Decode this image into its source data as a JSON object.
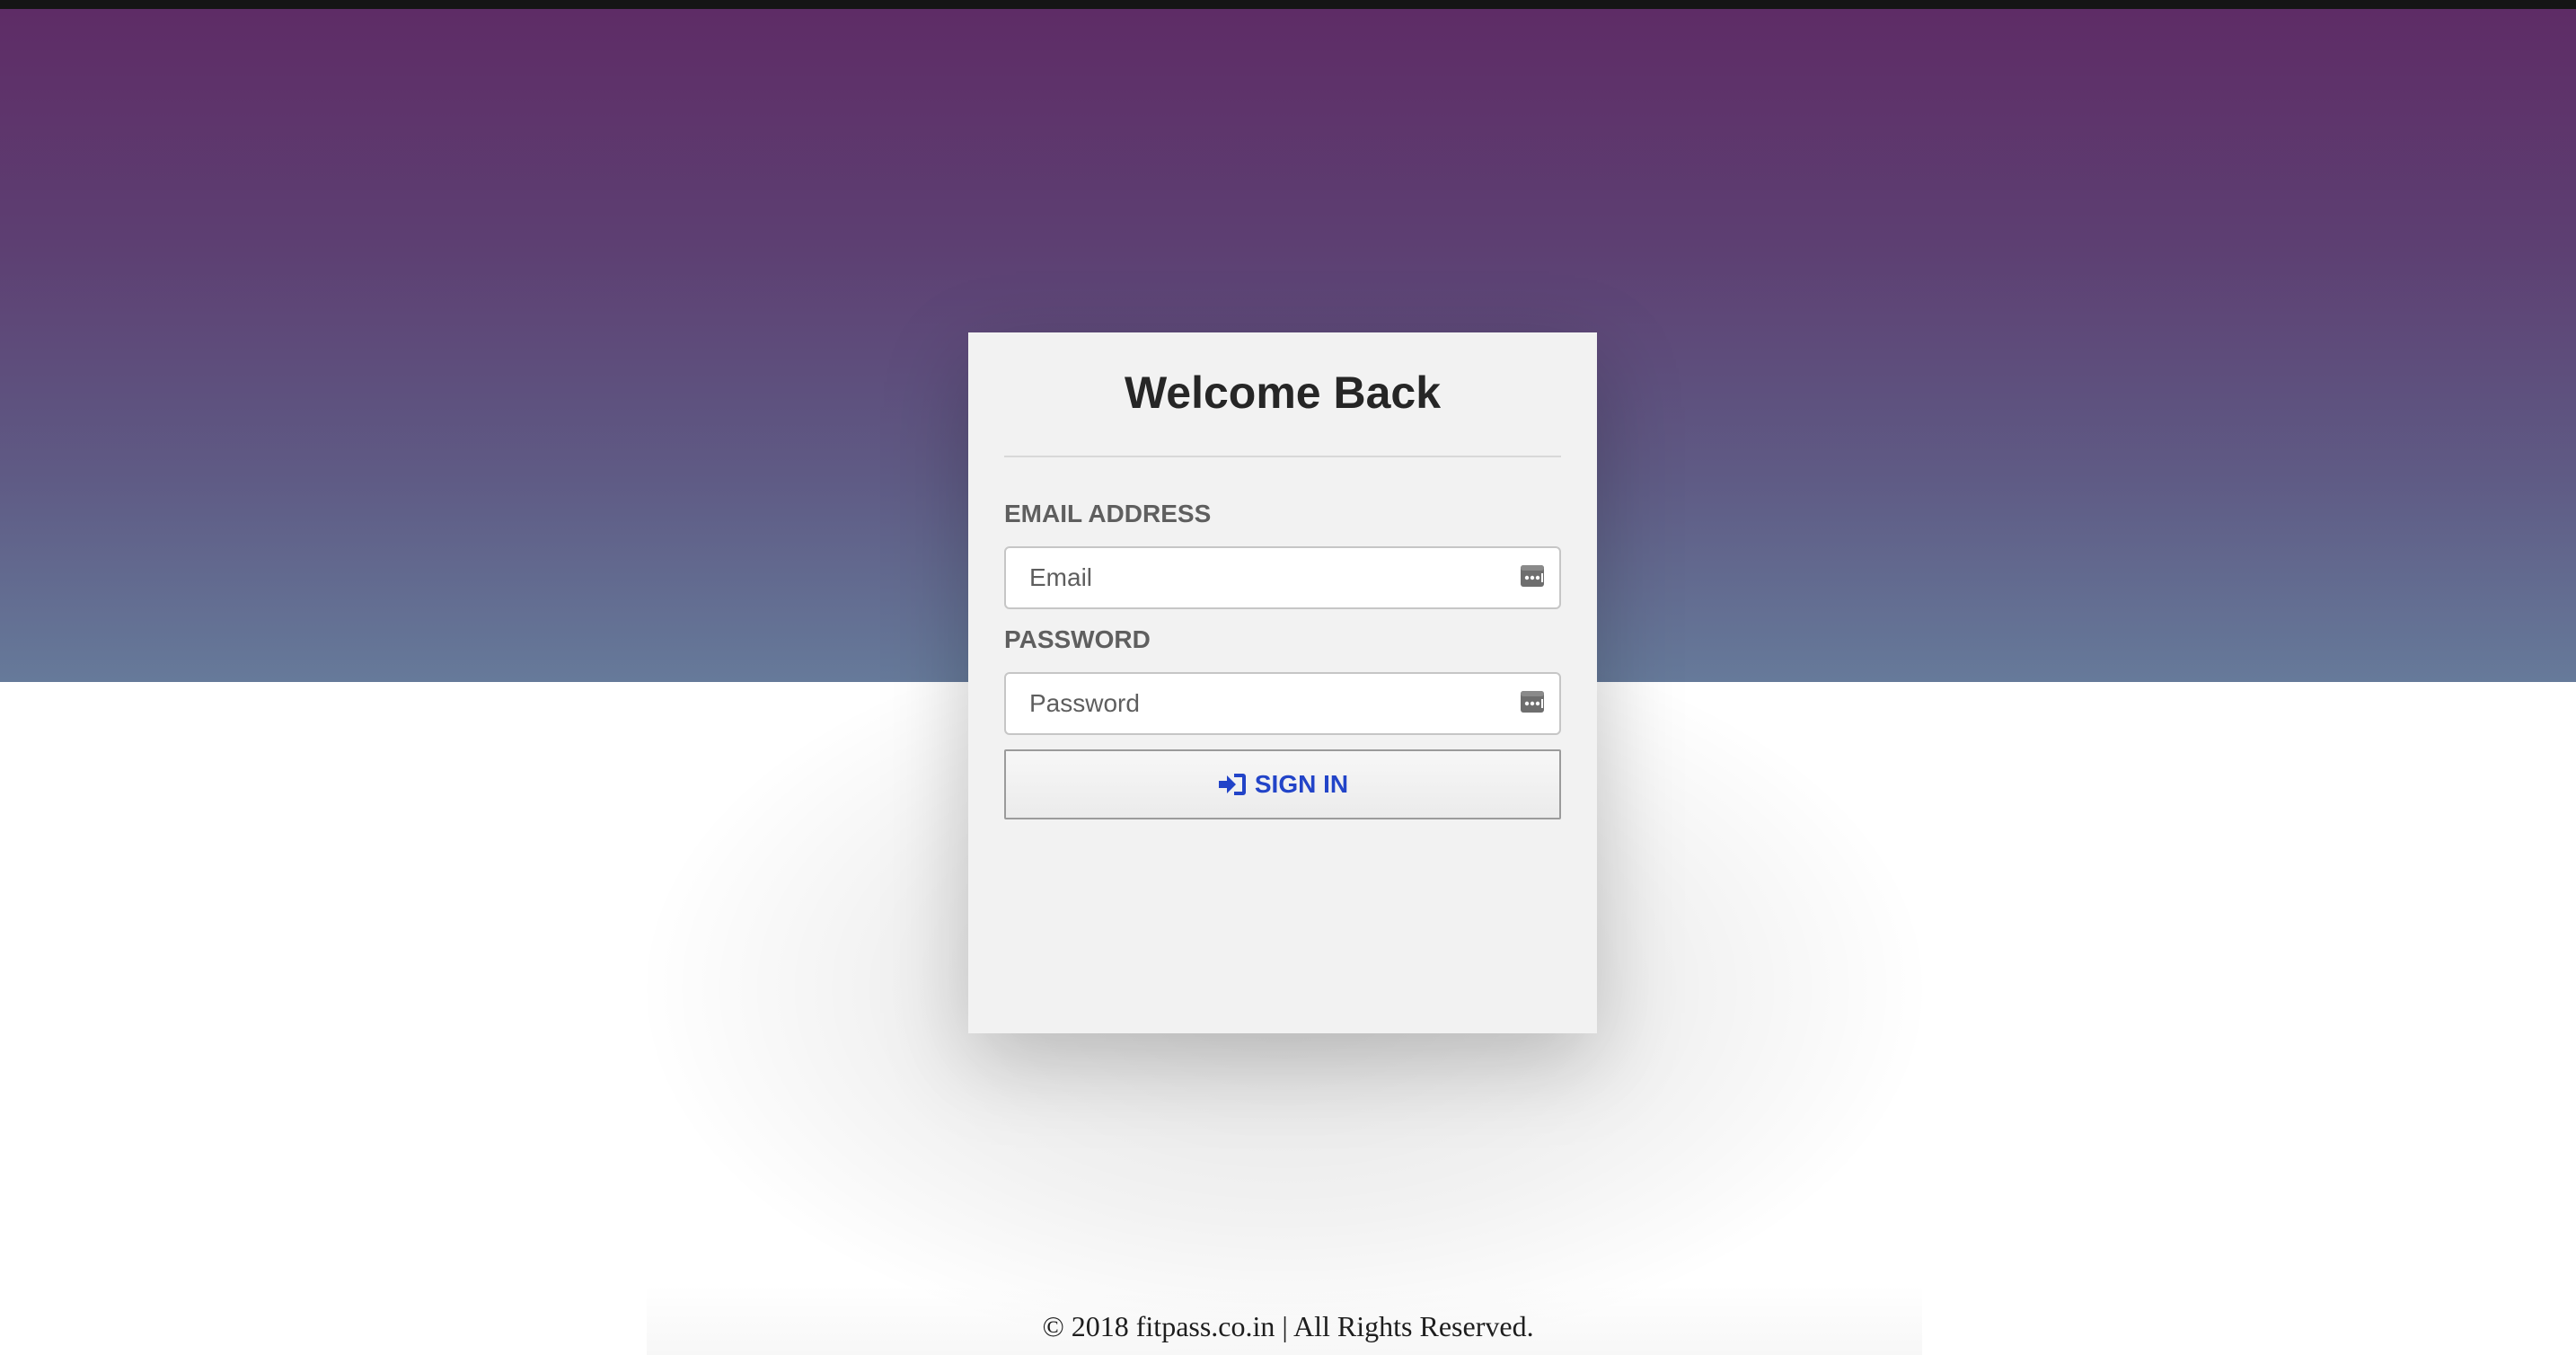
{
  "login": {
    "title": "Welcome Back",
    "email_label": "EMAIL ADDRESS",
    "email_placeholder": "Email",
    "email_value": "",
    "password_label": "PASSWORD",
    "password_placeholder": "Password",
    "password_value": "",
    "signin_label": "SIGN IN",
    "signin_icon": "sign-in-icon",
    "field_icon": "password-manager-key-icon"
  },
  "footer": {
    "text": "© 2018 fitpass.co.in | All Rights Reserved."
  },
  "colors": {
    "hero_top": "#5e2c66",
    "hero_bottom": "#667a9a",
    "card_background": "#f2f2f2",
    "accent": "#2244c8"
  }
}
